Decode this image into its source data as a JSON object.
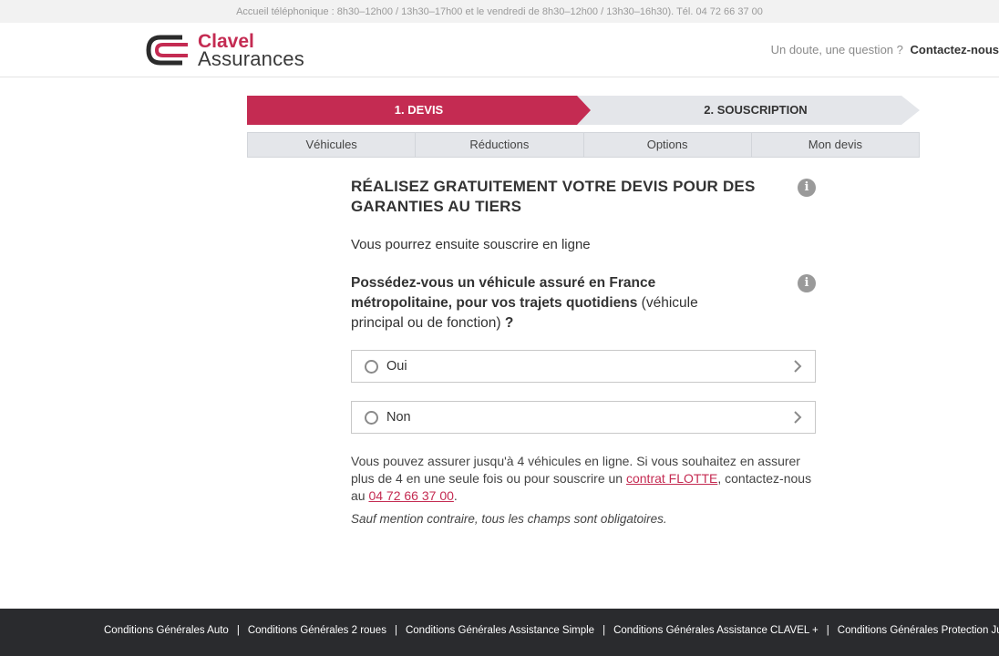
{
  "topbar": {
    "text": "Accueil téléphonique : 8h30–12h00 / 13h30–17h00 et le vendredi de 8h30–12h00 / 13h30–16h30). Tél. 04 72 66 37 00"
  },
  "header": {
    "logo_name": "Clavel",
    "logo_sub": "Assurances",
    "contact_question": "Un doute, une question ?",
    "contact_link": "Contactez-nous"
  },
  "steps": [
    {
      "label": "1. DEVIS",
      "active": true
    },
    {
      "label": "2. SOUSCRIPTION",
      "active": false
    }
  ],
  "subnav": [
    "Véhicules",
    "Réductions",
    "Options",
    "Mon devis"
  ],
  "main": {
    "title": "RÉALISEZ GRATUITEMENT VOTRE DEVIS POUR DES GARANTIES AU TIERS",
    "subtitle": "Vous pourrez ensuite souscrire en ligne",
    "question_bold": "Possédez-vous un véhicule assuré en France métropolitaine, pour vos trajets quotidiens",
    "question_normal": " (véhicule principal ou de fonction) ",
    "question_end": "?",
    "options": [
      "Oui",
      "Non"
    ],
    "note_part1": "Vous pouvez assurer jusqu'à 4 véhicules en ligne. Si vous souhaitez en assurer plus de 4 en une seule fois ou pour souscrire un ",
    "note_link1": "contrat FLOTTE",
    "note_part2": ", contactez-nous au ",
    "note_link2": "04 72 66 37 00",
    "note_part3": ".",
    "note2": "Sauf mention contraire, tous les champs sont obligatoires.",
    "info_icon": "i"
  },
  "footer": {
    "links": [
      "Conditions Générales Auto",
      "Conditions Générales 2 roues",
      "Conditions Générales Assistance Simple",
      "Conditions Générales Assistance CLAVEL +",
      "Conditions Générales Protection Juri"
    ],
    "separator": "|"
  },
  "colors": {
    "brand": "#c42b52",
    "footer_bg": "#2a2b2e",
    "step_inactive": "#e4e6ea"
  }
}
